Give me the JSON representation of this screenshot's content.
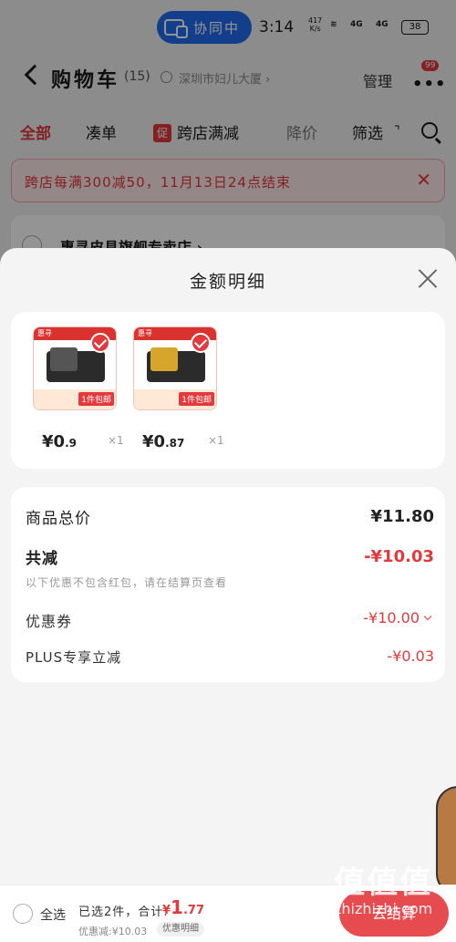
{
  "status_bar": {
    "collab_label": "协同中",
    "time": "3:14",
    "net_speed_value": "417",
    "net_speed_unit": "K/s",
    "signal_1": "4G",
    "signal_2": "4G",
    "battery": "38"
  },
  "header": {
    "title": "购物车",
    "count": "(15)",
    "location": "深圳市妇儿大厦 ›",
    "manage_label": "管理",
    "more_badge": "99"
  },
  "tabs": {
    "all": "全部",
    "combine": "凑单",
    "promo_tag": "促",
    "cross_store": "跨店满减",
    "price_drop": "降价",
    "filter": "筛选"
  },
  "notice": {
    "text": "跨店每满300减50，11月13日24点结束",
    "close": "✕"
  },
  "shop": {
    "name": "惠寻皮具旗舰专卖店 ›"
  },
  "sheet": {
    "title": "金额明细",
    "products": [
      {
        "price_int": "¥0",
        "price_dec": ".9",
        "qty": "×1",
        "tag": "惠寻",
        "pack": "1件包邮"
      },
      {
        "price_int": "¥0",
        "price_dec": ".87",
        "qty": "×1",
        "tag": "惠寻",
        "pack": "1件包邮"
      }
    ],
    "summary": {
      "total_label": "商品总价",
      "total_value": "¥11.80",
      "reduce_label": "共减",
      "reduce_value": "-¥10.03",
      "reduce_note": "以下优惠不包含红包，请在结算页查看",
      "coupon_label": "优惠券",
      "coupon_value": "-¥10.00",
      "plus_label": "PLUS专享立减",
      "plus_value": "-¥0.03"
    }
  },
  "bottom_bar": {
    "select_all": "全选",
    "selected_summary": "已选2件，合计:",
    "total_yen": "¥",
    "total_int": "1",
    "total_dec": ".77",
    "discount_line": "优惠减:¥10.03",
    "detail_pill": "优惠明细",
    "checkout": "去结算"
  },
  "watermark": {
    "logo": "值值值",
    "url": "zhizhizhi.com"
  },
  "colors": {
    "accent": "#e4393c",
    "collab_blue": "#1f6cf0"
  }
}
